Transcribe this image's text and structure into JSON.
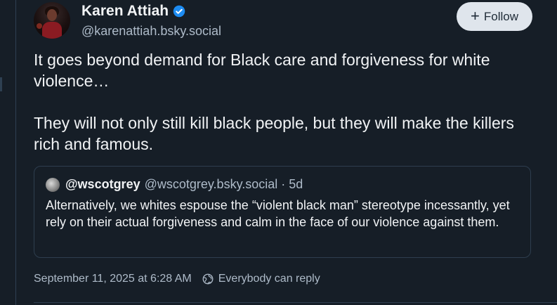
{
  "author": {
    "display_name": "Karen Attiah",
    "handle": "@karenattiah.bsky.social",
    "verified": true
  },
  "follow_button": {
    "label": "Follow"
  },
  "post": {
    "paragraphs": [
      "It goes beyond demand for Black care and forgiveness for white violence…",
      "They will not only still kill black people, but they will make the killers rich and famous."
    ]
  },
  "quote": {
    "name": "@wscotgrey",
    "handle": "@wscotgrey.bsky.social",
    "separator": "·",
    "age": "5d",
    "text": "Alternatively, we whites espouse the “violent black man” stereotype incessantly, yet rely on their actual forgiveness and calm in the face of our violence against them."
  },
  "meta": {
    "timestamp": "September 11, 2025 at 6:28 AM",
    "reply_setting": "Everybody can reply"
  },
  "colors": {
    "background": "#161e27",
    "verified_badge": "#1d8cf2",
    "follow_button_bg": "#dfe5ec",
    "muted_text": "#aebbc9"
  },
  "icons": {
    "verified": "verified-check-icon",
    "follow": "plus-icon",
    "reply_setting": "globe-icon"
  }
}
